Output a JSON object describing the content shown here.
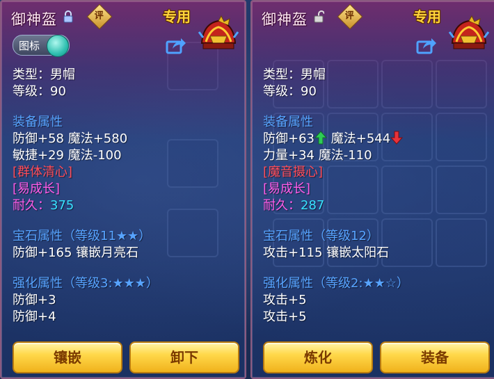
{
  "left_panel": {
    "title": "御神盔",
    "ping_badge": "评",
    "exclusive": "专用",
    "toggle_label": "图标",
    "lock_icon": "lock-closed-icon",
    "lines": {
      "type": "类型：男帽",
      "level": "等级：90",
      "equip_header": "装备属性",
      "attr1": "防御+58 魔法+580",
      "attr2": "敏捷+29 魔法-100",
      "effect": "[群体清心]",
      "trait": "[易成长]",
      "durability_label": "耐久：",
      "durability_value": "375",
      "gem_header": "宝石属性",
      "gem_level": "（等级11★★）",
      "gem_attr": "防御+165 镶嵌月亮石",
      "enh_header": "强化属性",
      "enh_level": "（等级3:★★★）",
      "enh1": "防御+3",
      "enh2": "防御+4"
    },
    "buttons": [
      "镶嵌",
      "卸下"
    ]
  },
  "right_panel": {
    "title": "御神盔",
    "ping_badge": "评",
    "exclusive": "专用",
    "lock_icon": "lock-open-icon",
    "lines": {
      "type": "类型：男帽",
      "level": "等级：90",
      "equip_header": "装备属性",
      "attr1a": "防御+63",
      "attr1b": "魔法+544",
      "attr2": "力量+34 魔法-110",
      "effect": "[魔音摄心]",
      "trait": "[易成长]",
      "durability_label": "耐久：",
      "durability_value": "287",
      "gem_header": "宝石属性",
      "gem_level": "（等级12）",
      "gem_attr": "攻击+115 镶嵌太阳石",
      "enh_header": "强化属性",
      "enh_level": "（等级2:★★☆）",
      "enh1": "攻击+5",
      "enh2": "攻击+5"
    },
    "buttons": [
      "炼化",
      "装备"
    ]
  },
  "colors": {
    "section_header": "#57a3ff",
    "effect_red": "#ff4d5a",
    "trait_pink": "#ff5ce8",
    "durability_cyan": "#38e1ff",
    "exclusive_gold": "#ffd43a",
    "arrow_up": "#2ecc55",
    "arrow_down": "#e8323a"
  }
}
